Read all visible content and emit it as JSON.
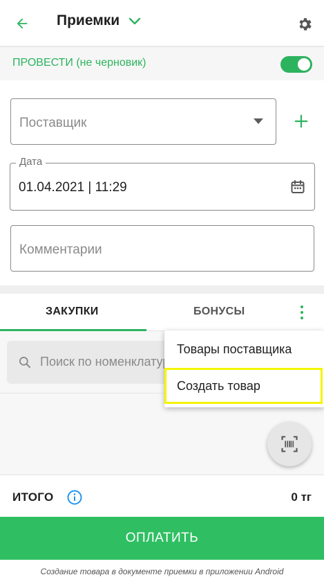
{
  "colors": {
    "accent": "#2db35e",
    "pay_button": "#2fbf62",
    "highlight": "#f5f500"
  },
  "appbar": {
    "title": "Приемки",
    "back_icon": "arrow-left-icon",
    "title_icon": "chevron-down-icon",
    "settings_icon": "gear-icon"
  },
  "post": {
    "label": "ПРОВЕСТИ (не черновик)",
    "toggle_on": true
  },
  "form": {
    "supplier_placeholder": "Поставщик",
    "date_label": "Дата",
    "date_value": "01.04.2021 | 11:29",
    "comment_placeholder": "Комментарии"
  },
  "tabs": [
    {
      "label": "ЗАКУПКИ",
      "active": true
    },
    {
      "label": "БОНУСЫ",
      "active": false
    }
  ],
  "search": {
    "placeholder": "Поиск по номенклатуре"
  },
  "menu": {
    "items": [
      {
        "label": "Товары поставщика",
        "highlighted": false
      },
      {
        "label": "Создать товар",
        "highlighted": true
      }
    ]
  },
  "total": {
    "label": "ИТОГО",
    "value": "0 тг"
  },
  "pay": {
    "label": "ОПЛАТИТЬ"
  },
  "caption": "Создание товара в документе приемки в приложении Android"
}
